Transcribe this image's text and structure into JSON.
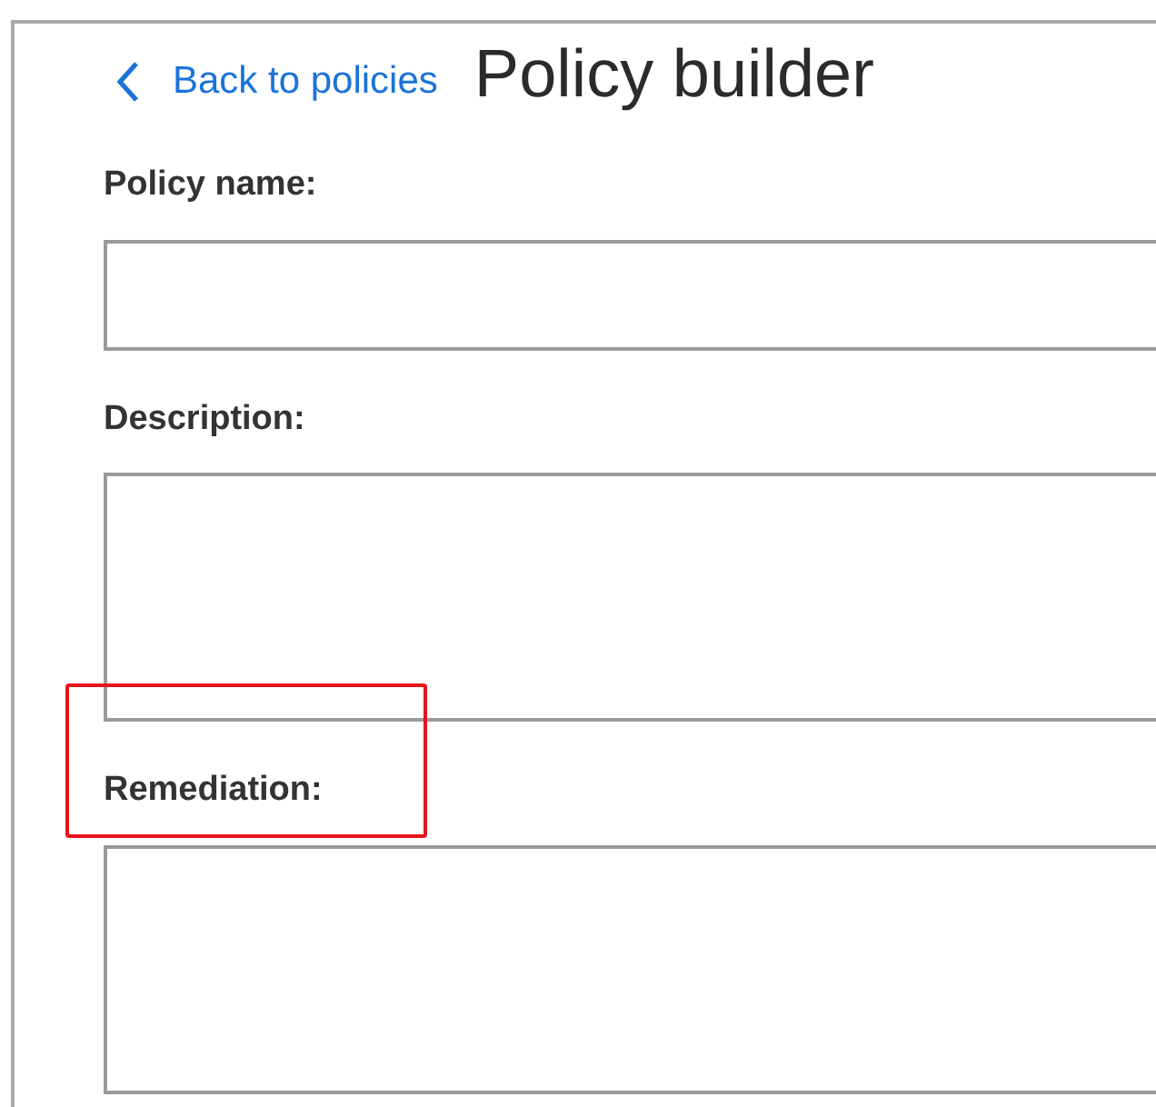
{
  "back_link": {
    "label": "Back to policies"
  },
  "title": "Policy builder",
  "fields": [
    {
      "label": "Policy name:",
      "kind": "input",
      "highlighted": false
    },
    {
      "label": "Description:",
      "kind": "textarea",
      "highlighted": false
    },
    {
      "label": "Remediation:",
      "kind": "textarea",
      "highlighted": true
    }
  ]
}
